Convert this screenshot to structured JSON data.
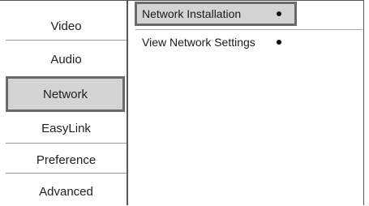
{
  "settings_menu": {
    "items": [
      {
        "label": "Video"
      },
      {
        "label": "Audio"
      },
      {
        "label": "Network",
        "selected": true
      },
      {
        "label": "EasyLink"
      },
      {
        "label": "Preference"
      },
      {
        "label": "Advanced"
      }
    ]
  },
  "network_submenu": {
    "items": [
      {
        "label": "Network Installation",
        "selected": true,
        "bullet": "●"
      },
      {
        "label": "View Network Settings",
        "selected": false,
        "bullet": "●"
      }
    ]
  },
  "colors": {
    "highlight_fill": "#d4d4d4",
    "highlight_border": "#6a6a6a",
    "frame": "#555555"
  }
}
